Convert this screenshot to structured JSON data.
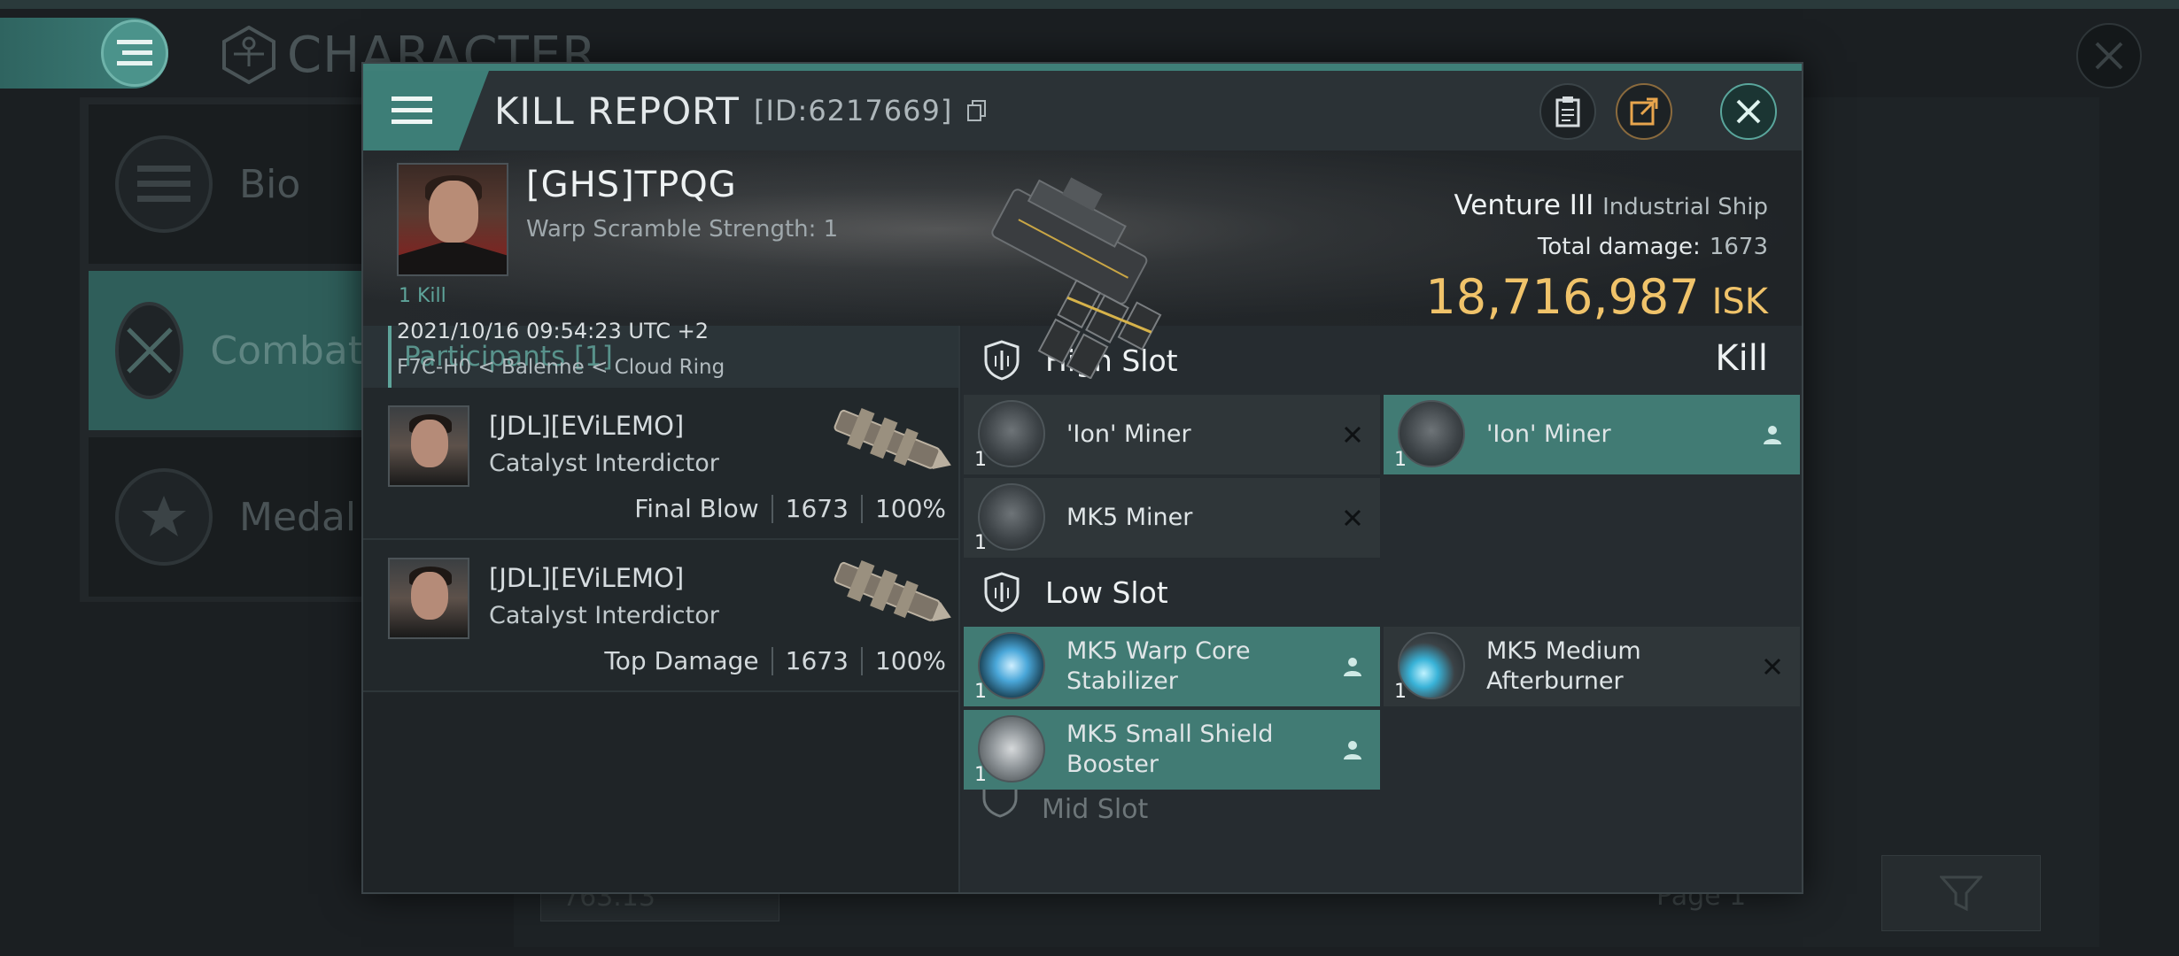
{
  "background": {
    "title": "CHARACTER",
    "sidebar": [
      {
        "label": "Bio",
        "icon": "list-icon"
      },
      {
        "label": "Combat",
        "icon": "crossed-swords-icon"
      },
      {
        "label": "Medal",
        "icon": "star-icon"
      }
    ],
    "value": "763.13",
    "page": "Page 1"
  },
  "report": {
    "title": "KILL REPORT",
    "id": "[ID:6217669]",
    "victim": {
      "name": "[GHS]TPQG",
      "warp_scramble": "Warp Scramble Strength: 1",
      "kills": "1 Kill",
      "timestamp": "2021/10/16 09:54:23 UTC +2",
      "location": "F7C-H0 < Balenne < Cloud Ring",
      "ship": "Venture III",
      "ship_class": "Industrial Ship",
      "damage_label": "Total damage:",
      "damage_value": "1673",
      "isk_value": "18,716,987",
      "isk_unit": "ISK",
      "result": "Kill"
    },
    "participants": {
      "header": "Participants [1]",
      "rows": [
        {
          "name": "[JDL][EViLEMO]",
          "ship": "Catalyst Interdictor",
          "role": "Final Blow",
          "damage": "1673",
          "percent": "100%"
        },
        {
          "name": "[JDL][EViLEMO]",
          "ship": "Catalyst Interdictor",
          "role": "Top Damage",
          "damage": "1673",
          "percent": "100%"
        }
      ]
    },
    "slots": {
      "high": {
        "title": "High Slot",
        "items": [
          {
            "name": "'Ion' Miner",
            "qty": "1",
            "status": "destroyed"
          },
          {
            "name": "'Ion' Miner",
            "qty": "1",
            "status": "dropped"
          },
          {
            "name": "MK5 Miner",
            "qty": "1",
            "status": "destroyed"
          }
        ]
      },
      "low": {
        "title": "Low Slot",
        "items": [
          {
            "name": "MK5 Warp Core Stabilizer",
            "qty": "1",
            "status": "dropped"
          },
          {
            "name": "MK5 Medium Afterburner",
            "qty": "1",
            "status": "destroyed"
          },
          {
            "name": "MK5 Small Shield Booster",
            "qty": "1",
            "status": "dropped"
          }
        ]
      },
      "next_title": "Mid Slot"
    }
  },
  "colors": {
    "accent": "#3d7e77",
    "isk": "#f0c36a",
    "highlight_slot": "#417b74"
  }
}
